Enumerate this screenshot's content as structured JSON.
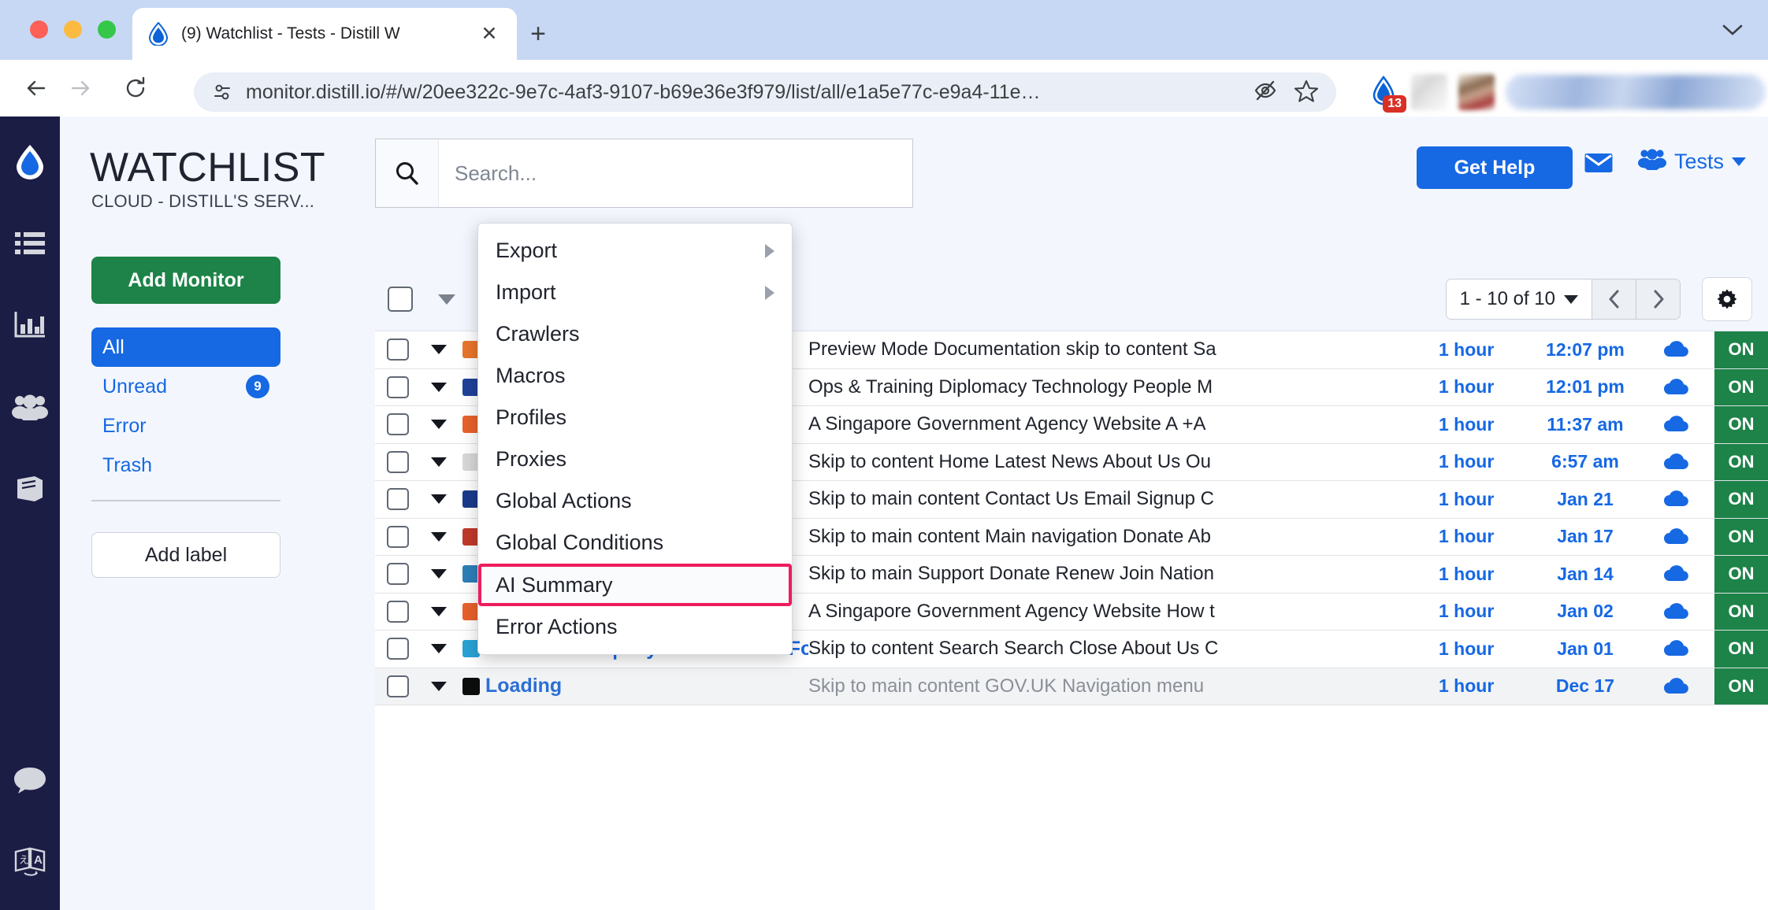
{
  "browser": {
    "tab_title": "(9) Watchlist - Tests - Distill W",
    "tab_favicon_name": "distill-droplet-icon",
    "close_label": "✕",
    "new_tab_label": "+",
    "url": "monitor.distill.io/#/w/20ee322c-9e7c-4af3-9107-b69e36e3f979/list/all/e1a5e77c-e9a4-11e…",
    "extension_badge": "13"
  },
  "rail": {
    "items": [
      {
        "name": "distill-logo-icon"
      },
      {
        "name": "list-icon"
      },
      {
        "name": "chart-icon"
      },
      {
        "name": "people-icon"
      },
      {
        "name": "book-icon"
      },
      {
        "name": "chat-icon"
      },
      {
        "name": "translate-icon"
      }
    ]
  },
  "sidebar": {
    "title": "WATCHLIST",
    "subtitle": "CLOUD - DISTILL'S SERV...",
    "add_monitor_label": "Add Monitor",
    "add_label_label": "Add label",
    "filters": [
      {
        "label": "All",
        "badge": "",
        "active": true
      },
      {
        "label": "Unread",
        "badge": "9",
        "active": false
      },
      {
        "label": "Error",
        "badge": "",
        "active": false
      },
      {
        "label": "Trash",
        "badge": "",
        "active": false
      }
    ]
  },
  "header": {
    "search_placeholder": "Search...",
    "search_value": "",
    "get_help_label": "Get Help",
    "account_label": "Tests"
  },
  "toolbar": {
    "pager_label": "1 - 10 of 10",
    "step1_label": "1",
    "step2_label": "2"
  },
  "dropdown": {
    "items": [
      {
        "label": "Export",
        "submenu": true,
        "highlighted": false
      },
      {
        "label": "Import",
        "submenu": true,
        "highlighted": false
      },
      {
        "label": "Crawlers",
        "submenu": false,
        "highlighted": false
      },
      {
        "label": "Macros",
        "submenu": false,
        "highlighted": false
      },
      {
        "label": "Profiles",
        "submenu": false,
        "highlighted": false
      },
      {
        "label": "Proxies",
        "submenu": false,
        "highlighted": false
      },
      {
        "label": "Global Actions",
        "submenu": false,
        "highlighted": false
      },
      {
        "label": "Global Conditions",
        "submenu": false,
        "highlighted": false
      },
      {
        "label": "AI Summary",
        "submenu": false,
        "highlighted": true
      },
      {
        "label": "Error Actions",
        "submenu": false,
        "highlighted": false
      }
    ]
  },
  "table": {
    "rows": [
      {
        "name": "",
        "snippet": "Preview Mode Documentation skip to content Sa",
        "freq": "1 hour",
        "date": "12:07 pm",
        "status": "ON",
        "fav": "#e8762c",
        "dim": false
      },
      {
        "name": "",
        "snippet": "Ops & Training Diplomacy Technology People M",
        "freq": "1 hour",
        "date": "12:01 pm",
        "status": "ON",
        "fav": "#20419a",
        "dim": false
      },
      {
        "name": "",
        "snippet": "A Singapore Government Agency Website A +A ",
        "freq": "1 hour",
        "date": "11:37 am",
        "status": "ON",
        "fav": "#e8622c",
        "dim": false
      },
      {
        "name": "",
        "snippet": "Skip to content Home Latest News About Us Ou",
        "freq": "1 hour",
        "date": "6:57 am",
        "status": "ON",
        "fav": "#d8d8d8",
        "dim": false
      },
      {
        "name": "",
        "snippet": "Skip to main content Contact Us Email Signup C",
        "freq": "1 hour",
        "date": "Jan 21",
        "status": "ON",
        "fav": "#1b3a8c",
        "dim": false
      },
      {
        "name": "",
        "snippet": "Skip to main content Main navigation Donate Ab",
        "freq": "1 hour",
        "date": "Jan 17",
        "status": "ON",
        "fav": "#c0392b",
        "dim": false
      },
      {
        "name": "",
        "snippet": "Skip to main Support Donate Renew Join Nation",
        "freq": "1 hour",
        "date": "Jan 14",
        "status": "ON",
        "fav": "#2c7fb8",
        "dim": false
      },
      {
        "name": "",
        "snippet": "A Singapore Government Agency Website How t",
        "freq": "1 hour",
        "date": "Jan 02",
        "status": "ON",
        "fav": "#e8622c",
        "dim": false
      },
      {
        "name": "Dunkin From | Joy in Childhood Foundation",
        "snippet": "Skip to content Search Search Close About Us C",
        "freq": "1 hour",
        "date": "Jan 01",
        "status": "ON",
        "fav": "#2aa3d6",
        "dim": false
      },
      {
        "name": "Loading",
        "snippet": "Skip to main content GOV.UK Navigation menu ",
        "freq": "1 hour",
        "date": "Dec 17",
        "status": "ON",
        "fav": "#0b0c0c",
        "dim": true
      }
    ]
  },
  "colors": {
    "accent_blue": "#1668e3",
    "green": "#1d8348",
    "highlight_pink": "#ee1c5c",
    "rail_dark": "#1b1d45"
  }
}
